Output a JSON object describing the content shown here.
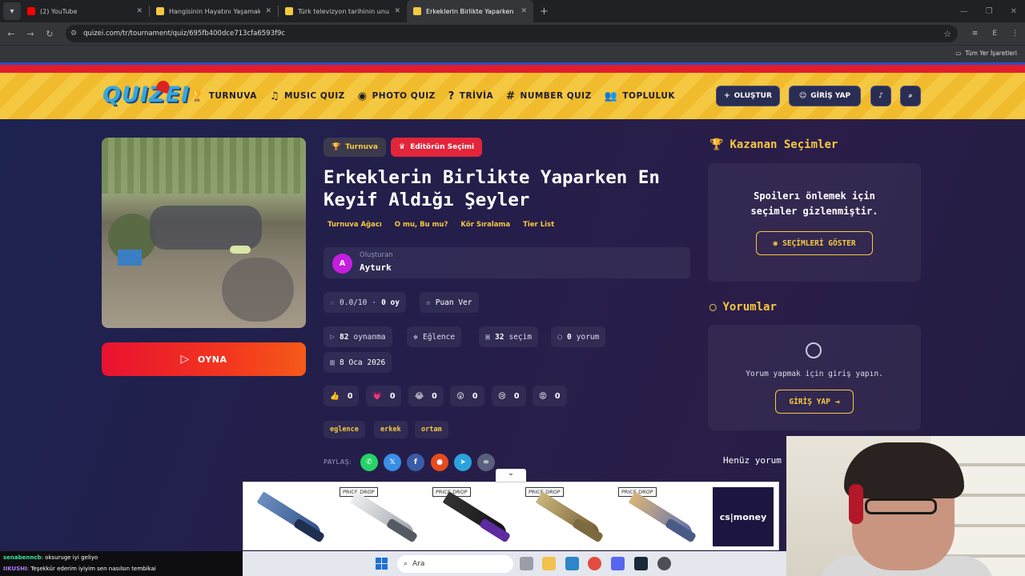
{
  "browser": {
    "tabs": [
      {
        "title": "(2) YouTube",
        "fav_color": "#ff0000"
      },
      {
        "title": "Hangisinin Hayatını Yaşamak İst",
        "fav_color": "#f5c842"
      },
      {
        "title": "Türk televizyon tarihinin unutul",
        "fav_color": "#f5c842"
      },
      {
        "title": "Erkeklerin Birlikte Yaparken En I",
        "fav_color": "#f5c842"
      }
    ],
    "url": "quizei.com/tr/tournament/quiz/695fb400dce713cfa6593f9c",
    "bookmarks_label": "Tüm Yer İşaretleri"
  },
  "header": {
    "logo": "QUIZEI",
    "nav": [
      {
        "icon": "🏆",
        "label": "TURNUVA"
      },
      {
        "icon": "♫",
        "label": "MUSIC QUIZ"
      },
      {
        "icon": "◉",
        "label": "PHOTO QUIZ"
      },
      {
        "icon": "?",
        "label": "TRİVİA"
      },
      {
        "icon": "#",
        "label": "NUMBER QUIZ"
      },
      {
        "icon": "👥",
        "label": "TOPLULUK"
      }
    ],
    "create_label": "OLUŞTUR",
    "login_label": "GİRİŞ YAP"
  },
  "play_label": "OYNA",
  "quiz": {
    "badge_type": "Turnuva",
    "badge_editor": "Editörün Seçimi",
    "title": "Erkeklerin Birlikte Yaparken En Keyif Aldığı Şeyler",
    "modes": [
      "Turnuva Ağacı",
      "O mu, Bu mu?",
      "Kör Sıralama",
      "Tier List"
    ],
    "creator_label": "Oluşturan",
    "creator_initial": "A",
    "creator_name": "Ayturk",
    "rating": "0.0/10",
    "votes": "0 oy",
    "rate_label": "Puan Ver",
    "plays": "82",
    "plays_label": "oynanma",
    "category": "Eğlence",
    "choices": "32",
    "choices_label": "seçim",
    "comments": "0",
    "comments_label": "yorum",
    "date": "8 Oca 2026",
    "reactions": [
      {
        "emoji": "👍",
        "count": "0"
      },
      {
        "emoji": "💗",
        "count": "0"
      },
      {
        "emoji": "😂",
        "count": "0"
      },
      {
        "emoji": "😲",
        "count": "0"
      },
      {
        "emoji": "😢",
        "count": "0"
      },
      {
        "emoji": "😡",
        "count": "0"
      }
    ],
    "tags": [
      "eglence",
      "erkek",
      "ortam"
    ],
    "share_label": "PAYLAŞ:"
  },
  "sidebar": {
    "winners_title": "Kazanan Seçimler",
    "spoiler_text_1": "Spoilerı önlemek için",
    "spoiler_text_2": "seçimler gizlenmiştir.",
    "show_button": "SEÇİMLERİ GÖSTER",
    "comments_title": "Yorumlar",
    "comment_hint": "Yorum yapmak için giriş yapın.",
    "login_button": "GİRİŞ YAP",
    "no_comments": "Henüz yorum"
  },
  "ad": {
    "price_drop": "PRICE DROP",
    "brand": "cs|money"
  },
  "stream_chat": [
    {
      "user": "senabenncb",
      "text": ": oksuruge iyi geliyo"
    },
    {
      "user": "IIKUSHI",
      "text": ": Teşekkür ederim iyiyim sen nasılsın tembikai"
    }
  ],
  "taskbar": {
    "search_label": "Ara"
  }
}
